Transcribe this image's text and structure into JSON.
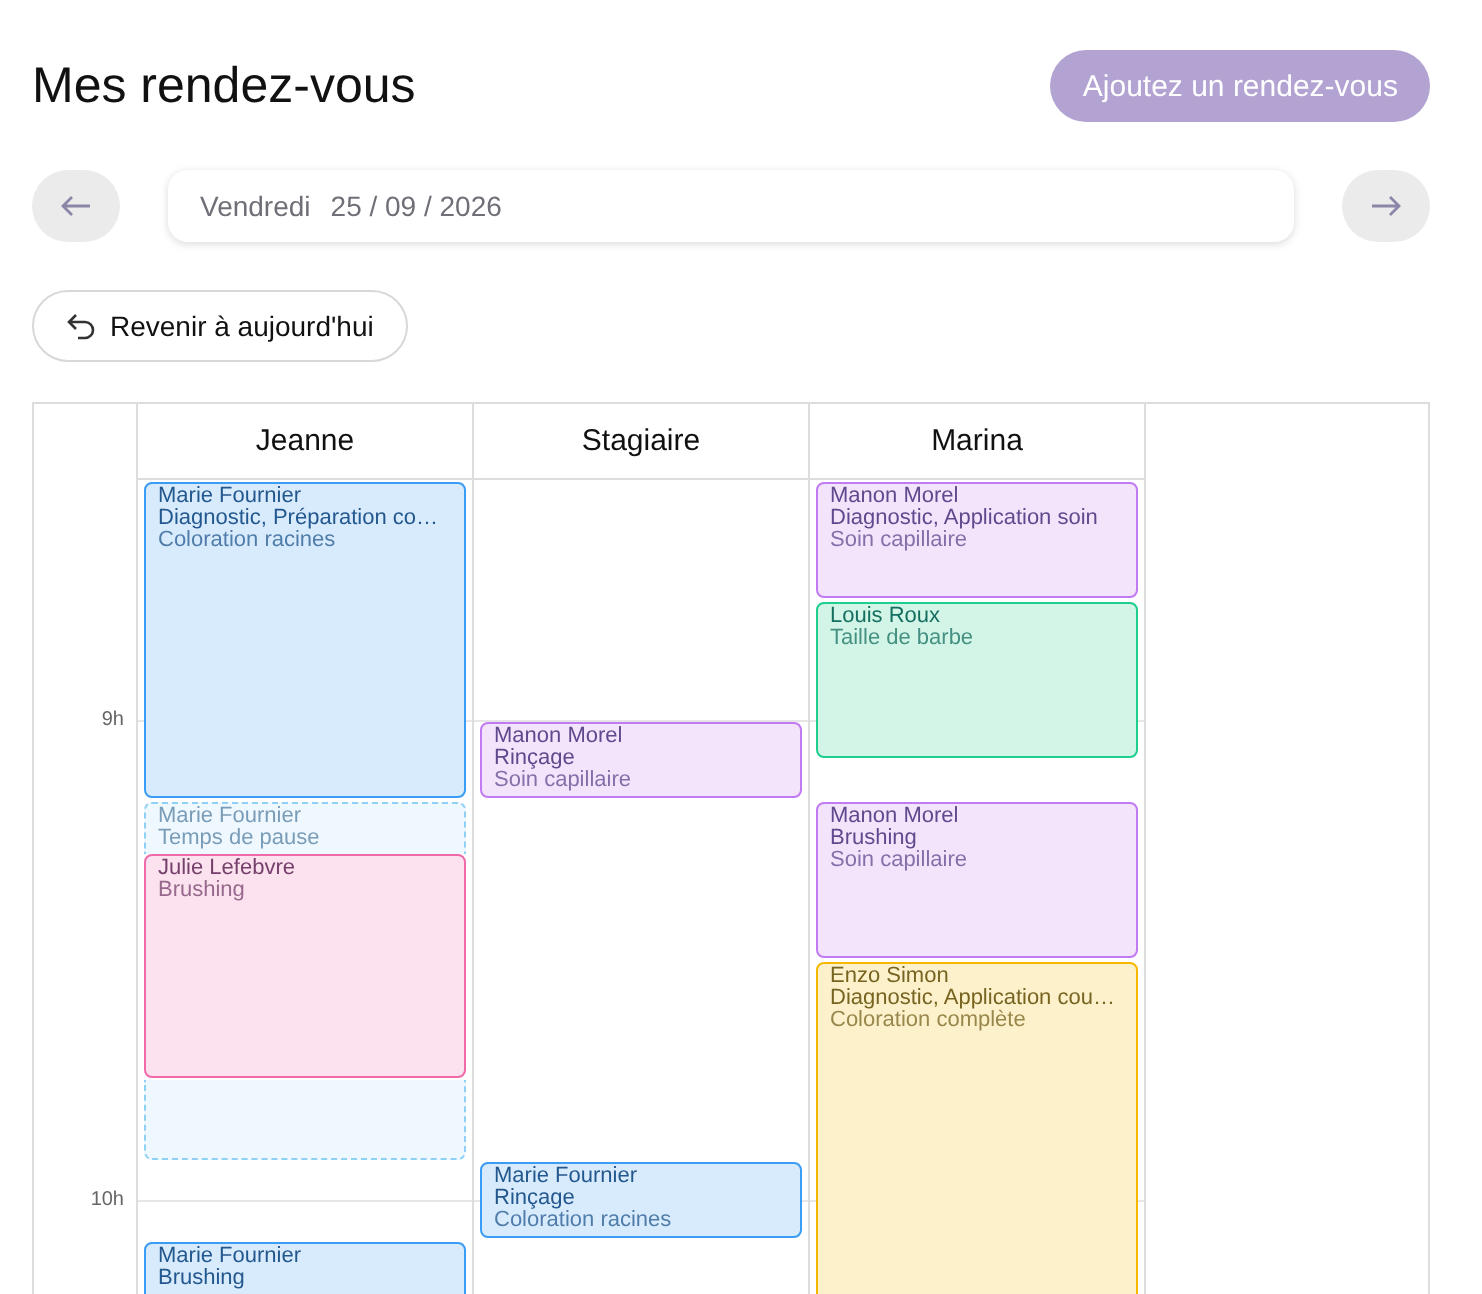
{
  "page": {
    "title": "Mes rendez-vous",
    "add_button": "Ajoutez un rendez-vous"
  },
  "date_nav": {
    "weekday": "Vendredi",
    "date": "25 / 09 / 2026"
  },
  "today_button": "Revenir à aujourd'hui",
  "calendar": {
    "hours": [
      {
        "label": "9h"
      },
      {
        "label": "10h"
      }
    ],
    "columns": [
      {
        "name": "Jeanne",
        "events": [
          {
            "kind": "appointment",
            "color": "#3b9cf5",
            "client": "Marie Fournier",
            "services": "Diagnostic, Préparation co…",
            "category": "Coloration racines"
          },
          {
            "kind": "pause",
            "color": "#8fd0f5",
            "client": "Marie Fournier",
            "category": "Temps de pause"
          },
          {
            "kind": "appointment",
            "color": "#f06aaa",
            "client": "Julie Lefebvre",
            "category": "Brushing"
          },
          {
            "kind": "appointment",
            "color": "#3b9cf5",
            "client": "Marie Fournier",
            "services": "Brushing"
          }
        ]
      },
      {
        "name": "Stagiaire",
        "events": [
          {
            "kind": "appointment",
            "color": "#c27af2",
            "client": "Manon Morel",
            "services": "Rinçage",
            "category": "Soin capillaire"
          },
          {
            "kind": "appointment",
            "color": "#3b9cf5",
            "client": "Marie Fournier",
            "services": "Rinçage",
            "category": "Coloration racines"
          }
        ]
      },
      {
        "name": "Marina",
        "events": [
          {
            "kind": "appointment",
            "color": "#c27af2",
            "client": "Manon Morel",
            "services": "Diagnostic, Application soin",
            "category": "Soin capillaire"
          },
          {
            "kind": "appointment",
            "color": "#1ccf8c",
            "client": "Louis Roux",
            "category": "Taille de barbe"
          },
          {
            "kind": "appointment",
            "color": "#c27af2",
            "client": "Manon Morel",
            "services": "Brushing",
            "category": "Soin capillaire"
          },
          {
            "kind": "appointment",
            "color": "#f5b800",
            "client": "Enzo Simon",
            "services": "Diagnostic, Application cou…",
            "category": "Coloration complète"
          }
        ]
      }
    ]
  }
}
